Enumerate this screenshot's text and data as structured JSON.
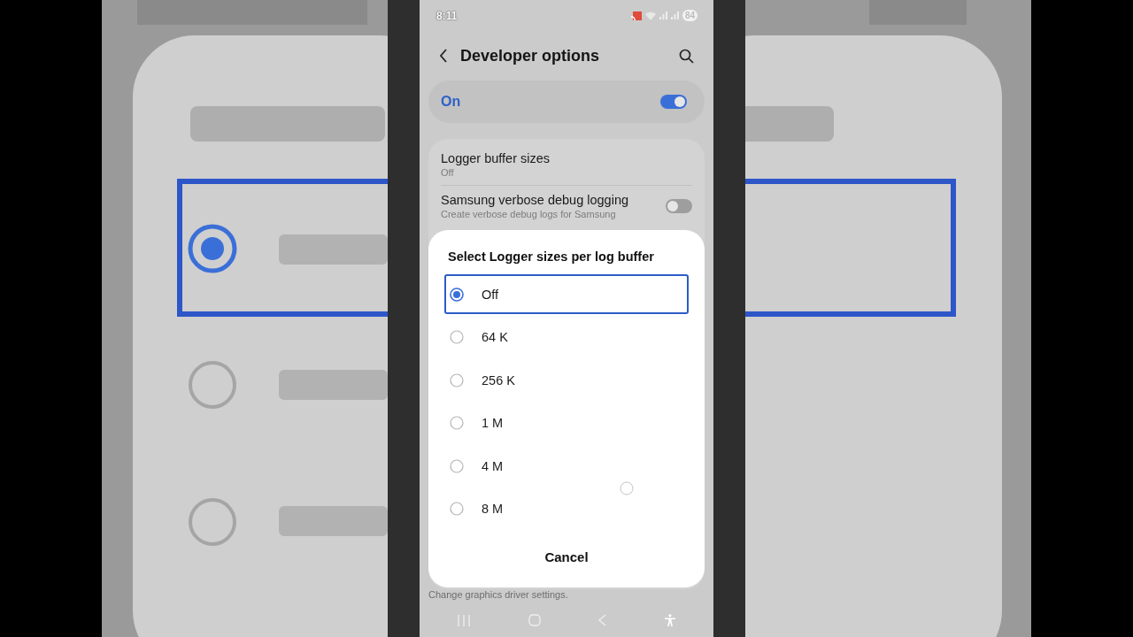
{
  "status_bar": {
    "time": "8:11",
    "battery": "84"
  },
  "header": {
    "title": "Developer options"
  },
  "master_switch": {
    "label": "On",
    "on": true
  },
  "settings": [
    {
      "kind": "value",
      "title": "Logger buffer sizes",
      "summary": "Off"
    },
    {
      "kind": "toggle",
      "title": "Samsung verbose debug logging",
      "summary": "Create verbose debug logs for Samsung",
      "on": false
    }
  ],
  "bottom_summary": "Change graphics driver settings.",
  "dialog": {
    "title": "Select Logger sizes per log buffer",
    "options": [
      {
        "label": "Off",
        "selected": true
      },
      {
        "label": "64 K",
        "selected": false
      },
      {
        "label": "256 K",
        "selected": false
      },
      {
        "label": "1 M",
        "selected": false
      },
      {
        "label": "4 M",
        "selected": false
      },
      {
        "label": "8 M",
        "selected": false
      }
    ],
    "cancel": "Cancel"
  }
}
